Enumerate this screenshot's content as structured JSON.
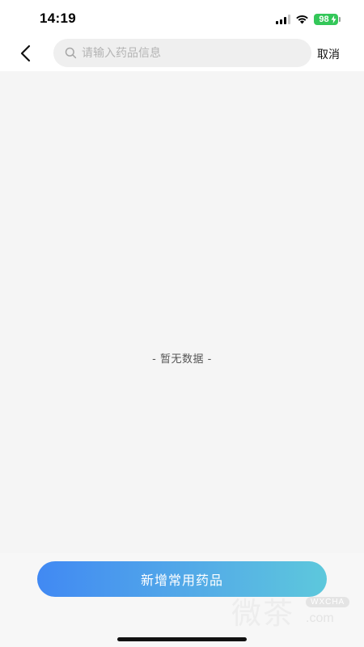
{
  "status_bar": {
    "time": "14:19",
    "battery_level": "98",
    "battery_color": "#34c759",
    "icons": [
      "signal-icon",
      "wifi-icon",
      "battery-icon",
      "bolt-icon"
    ]
  },
  "nav": {
    "back_icon": "chevron-left-icon",
    "search": {
      "icon": "search-icon",
      "placeholder": "请输入药品信息",
      "value": ""
    },
    "cancel_label": "取消"
  },
  "content": {
    "empty_text": "- 暂无数据 -"
  },
  "footer": {
    "add_button_label": "新增常用药品",
    "button_gradient": [
      "#4189f3",
      "#5dc8dc"
    ]
  },
  "watermark": {
    "text": "微茶",
    "tag": "WXCHA",
    "domain": ".com"
  }
}
